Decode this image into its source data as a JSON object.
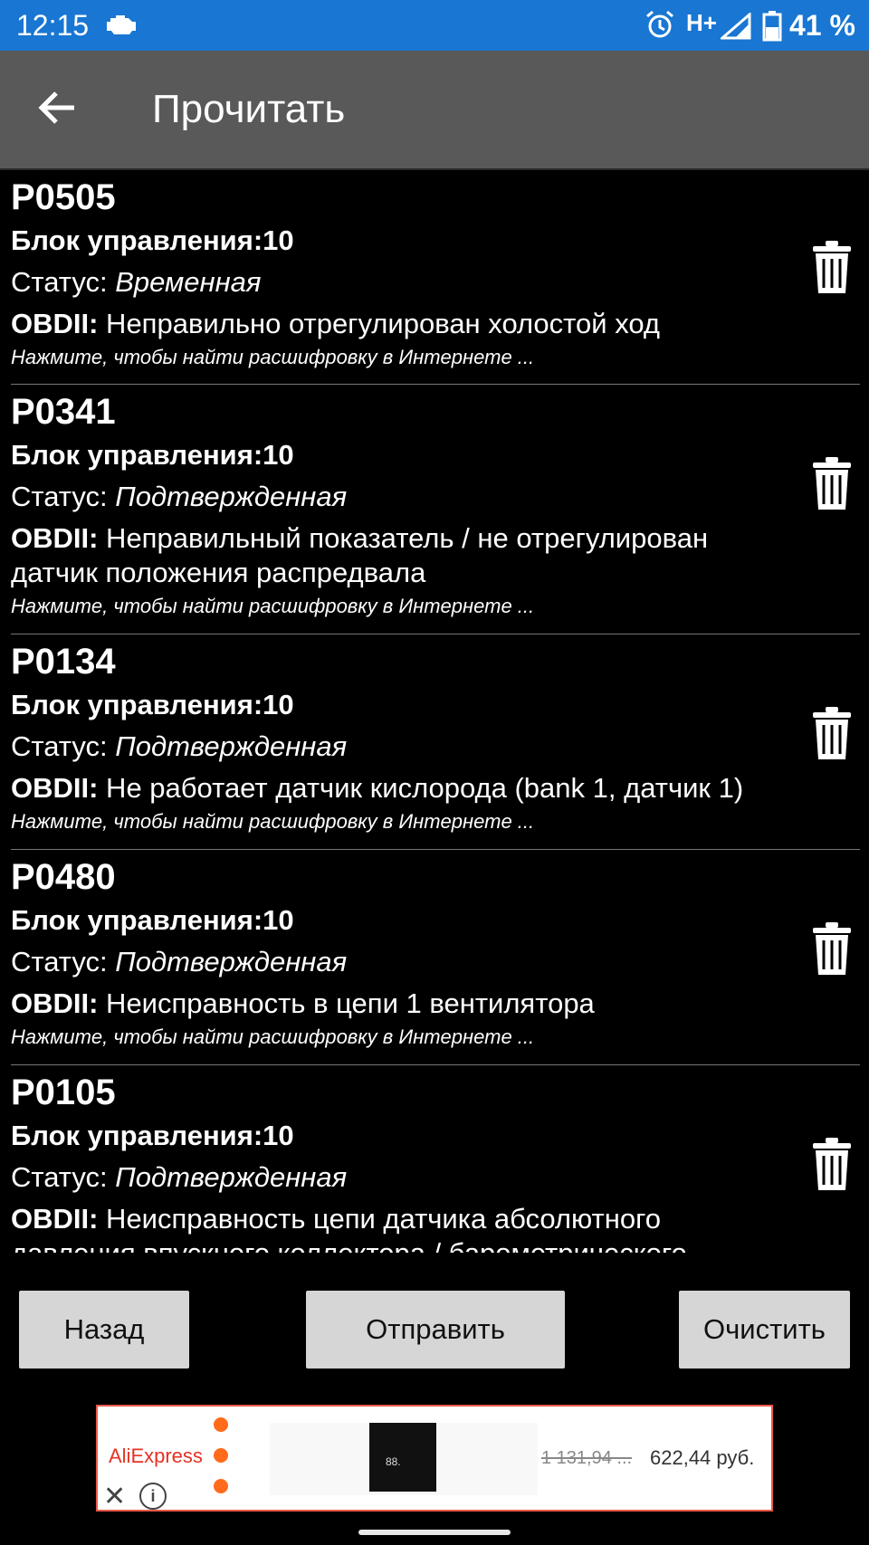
{
  "status_bar": {
    "time": "12:15",
    "network": "H+",
    "battery": "41 %"
  },
  "toolbar": {
    "title": "Прочитать"
  },
  "codes": [
    {
      "code": "P0505",
      "block": "Блок управления:10",
      "status_label": "Статус: ",
      "status_value": "Временная",
      "obd_label": "OBDII:",
      "obd_text": " Неправильно отрегулирован холостой ход",
      "hint": "Нажмите, чтобы найти расшифровку в Интернете ..."
    },
    {
      "code": "P0341",
      "block": "Блок управления:10",
      "status_label": "Статус: ",
      "status_value": "Подтвержденная",
      "obd_label": "OBDII:",
      "obd_text": " Неправильный показатель / не отрегулирован датчик положения распредвала",
      "hint": "Нажмите, чтобы найти расшифровку в Интернете ..."
    },
    {
      "code": "P0134",
      "block": "Блок управления:10",
      "status_label": "Статус: ",
      "status_value": "Подтвержденная",
      "obd_label": "OBDII:",
      "obd_text": " Не работает датчик кислорода (bank 1, датчик 1)",
      "hint": "Нажмите, чтобы найти расшифровку в Интернете ..."
    },
    {
      "code": "P0480",
      "block": "Блок управления:10",
      "status_label": "Статус: ",
      "status_value": "Подтвержденная",
      "obd_label": "OBDII:",
      "obd_text": " Неисправность в цепи 1 вентилятора",
      "hint": "Нажмите, чтобы найти расшифровку в Интернете ..."
    },
    {
      "code": "P0105",
      "block": "Блок управления:10",
      "status_label": "Статус: ",
      "status_value": "Подтвержденная",
      "obd_label": "OBDII:",
      "obd_text": " Неисправность цепи датчика абсолютного давления впускного коллектора / барометрического",
      "hint": ""
    }
  ],
  "buttons": {
    "back": "Назад",
    "send": "Отправить",
    "clear": "Очистить"
  },
  "ad": {
    "brand": "AliExpress",
    "old_price": "1 131,94 ...",
    "new_price": "622,44 руб.",
    "close": "✕",
    "info": "i",
    "thumb_text": "88."
  },
  "colors": {
    "status_bar": "#1976d2",
    "toolbar": "#595959",
    "button": "#d6d6d6",
    "ad_accent": "#e43225"
  }
}
